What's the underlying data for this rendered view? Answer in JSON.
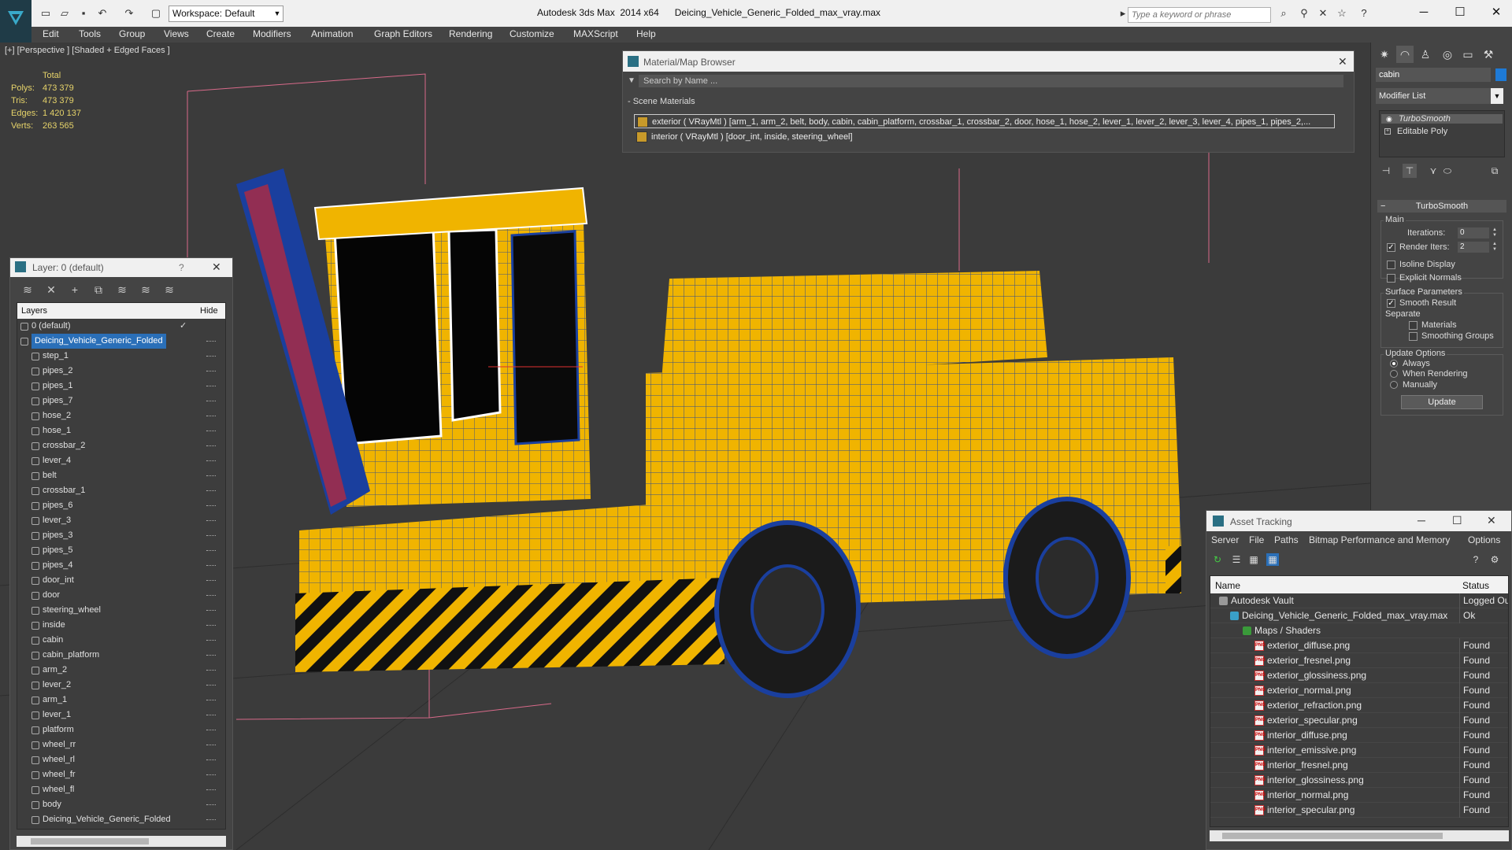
{
  "app": {
    "title": "Autodesk 3ds Max  2014 x64      Deicing_Vehicle_Generic_Folded_max_vray.max",
    "workspace_label": "Workspace: Default",
    "search_placeholder": "Type a keyword or phrase"
  },
  "menu": [
    "Edit",
    "Tools",
    "Group",
    "Views",
    "Create",
    "Modifiers",
    "Animation",
    "Graph Editors",
    "Rendering",
    "Customize",
    "MAXScript",
    "Help"
  ],
  "viewport": {
    "label": "[+] [Perspective ] [Shaded + Edged Faces ]",
    "stats": {
      "header": "Total",
      "polys_label": "Polys:",
      "polys": "473 379",
      "tris_label": "Tris:",
      "tris": "473 379",
      "edges_label": "Edges:",
      "edges": "1 420 137",
      "verts_label": "Verts:",
      "verts": "263 565"
    }
  },
  "layer_panel": {
    "title": "Layer: 0 (default)",
    "help": "?",
    "col_layers": "Layers",
    "col_hide": "Hide",
    "layers": [
      {
        "name": "0 (default)"
      },
      {
        "name": "Deicing_Vehicle_Generic_Folded"
      },
      {
        "name": "step_1"
      },
      {
        "name": "pipes_2"
      },
      {
        "name": "pipes_1"
      },
      {
        "name": "pipes_7"
      },
      {
        "name": "hose_2"
      },
      {
        "name": "hose_1"
      },
      {
        "name": "crossbar_2"
      },
      {
        "name": "lever_4"
      },
      {
        "name": "belt"
      },
      {
        "name": "crossbar_1"
      },
      {
        "name": "pipes_6"
      },
      {
        "name": "lever_3"
      },
      {
        "name": "pipes_3"
      },
      {
        "name": "pipes_5"
      },
      {
        "name": "pipes_4"
      },
      {
        "name": "door_int"
      },
      {
        "name": "door"
      },
      {
        "name": "steering_wheel"
      },
      {
        "name": "inside"
      },
      {
        "name": "cabin"
      },
      {
        "name": "cabin_platform"
      },
      {
        "name": "arm_2"
      },
      {
        "name": "lever_2"
      },
      {
        "name": "arm_1"
      },
      {
        "name": "lever_1"
      },
      {
        "name": "platform"
      },
      {
        "name": "wheel_rr"
      },
      {
        "name": "wheel_rl"
      },
      {
        "name": "wheel_fr"
      },
      {
        "name": "wheel_fl"
      },
      {
        "name": "body"
      },
      {
        "name": "Deicing_Vehicle_Generic_Folded"
      }
    ]
  },
  "material_browser": {
    "title": "Material/Map Browser",
    "search_placeholder": "Search by Name ...",
    "section": "- Scene Materials",
    "materials": [
      "exterior  ( VRayMtl ) [arm_1, arm_2, belt, body, cabin, cabin_platform, crossbar_1, crossbar_2, door, hose_1, hose_2, lever_1, lever_2, lever_3, lever_4, pipes_1, pipes_2,...",
      "interior  ( VRayMtl ) [door_int, inside, steering_wheel]"
    ]
  },
  "command_panel": {
    "object_name": "cabin",
    "object_color": "#1e7ad6",
    "modifier_list": "Modifier List",
    "stack": [
      "TurboSmooth",
      "Editable Poly"
    ],
    "rollout_title": "TurboSmooth",
    "main_label": "Main",
    "iterations_label": "Iterations:",
    "iterations": "0",
    "render_iters_label": "Render Iters:",
    "render_iters": "2",
    "isoline_label": "Isoline Display",
    "explicit_label": "Explicit Normals",
    "surface_label": "Surface Parameters",
    "smooth_label": "Smooth Result",
    "separate_label": "Separate",
    "materials_label": "Materials",
    "smoothing_label": "Smoothing Groups",
    "update_options_label": "Update Options",
    "always_label": "Always",
    "when_rendering_label": "When Rendering",
    "manually_label": "Manually",
    "update_button": "Update"
  },
  "asset_tracking": {
    "title": "Asset Tracking",
    "menu": [
      "Server",
      "File",
      "Paths",
      "Bitmap Performance and Memory",
      "Options"
    ],
    "col_name": "Name",
    "col_status": "Status",
    "rows": [
      {
        "name": "Autodesk Vault",
        "status": "Logged Out",
        "indent": 0
      },
      {
        "name": "Deicing_Vehicle_Generic_Folded_max_vray.max",
        "status": "Ok",
        "indent": 1
      },
      {
        "name": "Maps / Shaders",
        "status": "",
        "indent": 2
      },
      {
        "name": "exterior_diffuse.png",
        "status": "Found",
        "indent": 3
      },
      {
        "name": "exterior_fresnel.png",
        "status": "Found",
        "indent": 3
      },
      {
        "name": "exterior_glossiness.png",
        "status": "Found",
        "indent": 3
      },
      {
        "name": "exterior_normal.png",
        "status": "Found",
        "indent": 3
      },
      {
        "name": "exterior_refraction.png",
        "status": "Found",
        "indent": 3
      },
      {
        "name": "exterior_specular.png",
        "status": "Found",
        "indent": 3
      },
      {
        "name": "interior_diffuse.png",
        "status": "Found",
        "indent": 3
      },
      {
        "name": "interior_emissive.png",
        "status": "Found",
        "indent": 3
      },
      {
        "name": "interior_fresnel.png",
        "status": "Found",
        "indent": 3
      },
      {
        "name": "interior_glossiness.png",
        "status": "Found",
        "indent": 3
      },
      {
        "name": "interior_normal.png",
        "status": "Found",
        "indent": 3
      },
      {
        "name": "interior_specular.png",
        "status": "Found",
        "indent": 3
      }
    ]
  },
  "colors": {
    "vehicle_yellow": "#f0b400",
    "wire_blue": "#1a3f9e",
    "stats_text": "#e6d36a",
    "selection_blue": "#2a6fb8"
  }
}
